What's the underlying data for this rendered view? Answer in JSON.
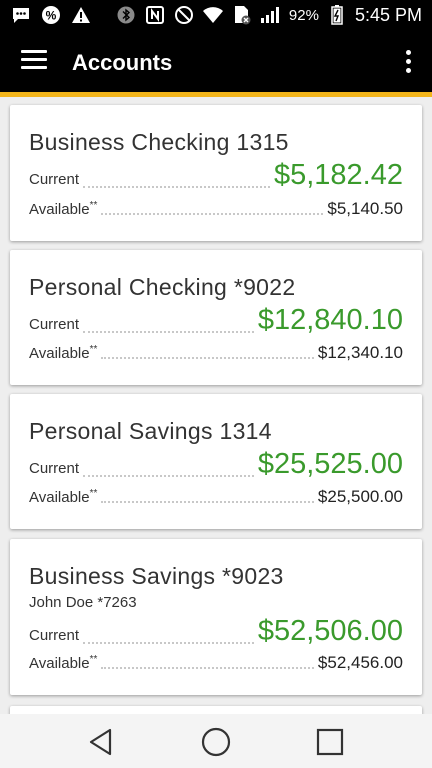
{
  "status_bar": {
    "battery_percent": "92%",
    "time": "5:45 PM",
    "icons": [
      "message-icon",
      "percent-icon",
      "warning-icon",
      "bluetooth-icon",
      "nfc-icon",
      "mute-icon",
      "wifi-icon",
      "sim-icon",
      "signal-icon",
      "battery-icon"
    ]
  },
  "app_bar": {
    "title": "Accounts",
    "menu_icon": "hamburger-menu-icon",
    "overflow_icon": "more-vert-icon",
    "accent_color": "#f3b51b"
  },
  "labels": {
    "current": "Current",
    "available": "Available",
    "available_marker": "**"
  },
  "accounts": [
    {
      "name": "Business Checking 1315",
      "holder": "",
      "current": "$5,182.42",
      "available": "$5,140.50"
    },
    {
      "name": "Personal Checking *9022",
      "holder": "",
      "current": "$12,840.10",
      "available": "$12,340.10"
    },
    {
      "name": "Personal Savings 1314",
      "holder": "",
      "current": "$25,525.00",
      "available": "$25,500.00"
    },
    {
      "name": "Business Savings *9023",
      "holder": "John Doe *7263",
      "current": "$52,506.00",
      "available": "$52,456.00"
    }
  ],
  "colors": {
    "balance_green": "#3a9a2c",
    "header_bg": "#000000"
  },
  "nav_bar": {
    "icons": [
      "back-icon",
      "home-icon",
      "recents-icon"
    ]
  }
}
